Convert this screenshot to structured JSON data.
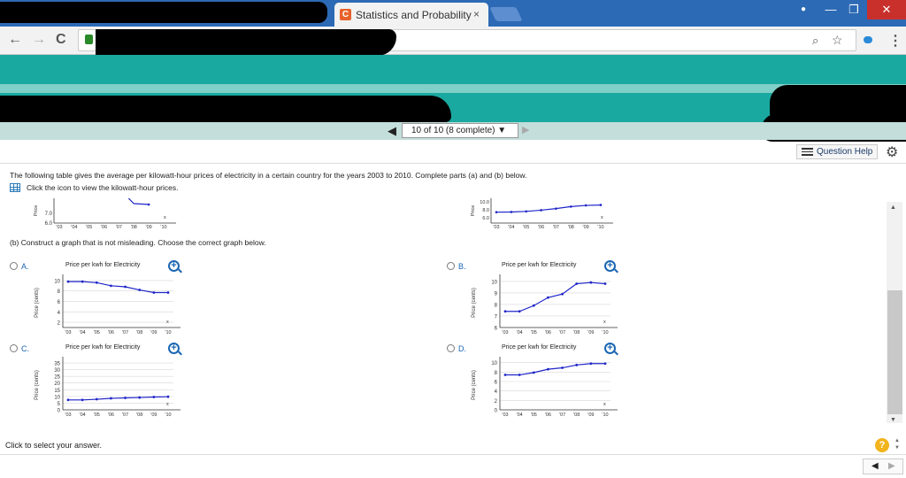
{
  "browser": {
    "tab_title": "Statistics and Probability",
    "tab_close": "×",
    "favicon_letter": "C",
    "window_controls": {
      "minimize": "—",
      "maximize": "❐",
      "close": "✕"
    },
    "nav": {
      "back": "←",
      "forward": "→",
      "reload": "C"
    },
    "address_icons": {
      "zoom": "🔍",
      "star": "☆",
      "menu": "⋮"
    }
  },
  "pager": {
    "prev": "◀",
    "label": "10 of 10 (8 complete) ▼",
    "next": "▶"
  },
  "question_help": {
    "label": "Question Help"
  },
  "question": {
    "intro": "The following table gives the average per kilowatt-hour prices of electricity in a certain country for the years 2003 to 2010. Complete parts (a) and (b) below.",
    "icon_link": "Click the icon to view the kilowatt-hour prices.",
    "part_b": "(b) Construct a graph that is not misleading. Choose the correct graph below."
  },
  "options": [
    {
      "letter": "A.",
      "title": "Price per kwh for Electricity"
    },
    {
      "letter": "B.",
      "title": "Price per kwh for Electricity"
    },
    {
      "letter": "C.",
      "title": "Price per kwh for Electricity"
    },
    {
      "letter": "D.",
      "title": "Price per kwh for Electricity"
    }
  ],
  "footer": {
    "instruction": "Click to select your answer.",
    "help_symbol": "?"
  },
  "chart_data": [
    {
      "id": "partial-left",
      "type": "line",
      "ylabel": "Price",
      "xlabel": "x",
      "x": [
        "'03",
        "'04",
        "'05",
        "'06",
        "'07",
        "'08",
        "'09",
        "'10"
      ],
      "yticks": [
        6.0,
        7.0
      ],
      "visible_series_fragment": [
        7.6,
        7.55
      ]
    },
    {
      "id": "partial-right",
      "type": "line",
      "ylabel": "Price",
      "xlabel": "x",
      "x": [
        "'03",
        "'04",
        "'05",
        "'06",
        "'07",
        "'08",
        "'09",
        "'10"
      ],
      "yticks": [
        6.0,
        8.0,
        10.0
      ],
      "ylim": [
        6,
        10
      ],
      "values": [
        7.4,
        7.45,
        7.6,
        7.9,
        8.3,
        8.8,
        9.1,
        9.2
      ]
    },
    {
      "id": "A",
      "type": "line",
      "title": "Price per kwh for Electricity",
      "ylabel": "Price (cents)",
      "xlabel": "x",
      "x": [
        "'03",
        "'04",
        "'05",
        "'06",
        "'07",
        "'08",
        "'09",
        "'10"
      ],
      "yticks": [
        2,
        4,
        6,
        8,
        10
      ],
      "ylim": [
        1,
        10.5
      ],
      "values": [
        9.8,
        9.8,
        9.6,
        9.0,
        8.8,
        8.2,
        7.7,
        7.7
      ]
    },
    {
      "id": "B",
      "type": "line",
      "title": "Price per kwh for Electricity",
      "ylabel": "Price (cents)",
      "xlabel": "x",
      "x": [
        "'03",
        "'04",
        "'05",
        "'06",
        "'07",
        "'08",
        "'09",
        "'10"
      ],
      "yticks": [
        6,
        7,
        8,
        9,
        10
      ],
      "ylim": [
        6,
        10.3
      ],
      "values": [
        7.4,
        7.4,
        7.9,
        8.6,
        8.9,
        9.8,
        9.9,
        9.8
      ]
    },
    {
      "id": "C",
      "type": "line",
      "title": "Price per kwh for Electricity",
      "ylabel": "Price (cents)",
      "xlabel": "x",
      "x": [
        "'03",
        "'04",
        "'05",
        "'06",
        "'07",
        "'08",
        "'09",
        "'10"
      ],
      "yticks": [
        0,
        5,
        10,
        15,
        20,
        25,
        30,
        35
      ],
      "ylim": [
        0,
        37
      ],
      "values": [
        7.4,
        7.4,
        7.9,
        8.6,
        8.9,
        9.2,
        9.6,
        9.8
      ]
    },
    {
      "id": "D",
      "type": "line",
      "title": "Price per kwh for Electricity",
      "ylabel": "Price (cents)",
      "xlabel": "x",
      "x": [
        "'03",
        "'04",
        "'05",
        "'06",
        "'07",
        "'08",
        "'09",
        "'10"
      ],
      "yticks": [
        0,
        2,
        4,
        6,
        8,
        10
      ],
      "ylim": [
        0,
        10.5
      ],
      "values": [
        7.4,
        7.4,
        7.9,
        8.6,
        8.9,
        9.5,
        9.8,
        9.8
      ]
    }
  ],
  "colors": {
    "accent_teal": "#1aa9a0",
    "title_bar": "#2d6ab5",
    "series": "#1f25c9",
    "radio_link": "#1a66b3"
  }
}
